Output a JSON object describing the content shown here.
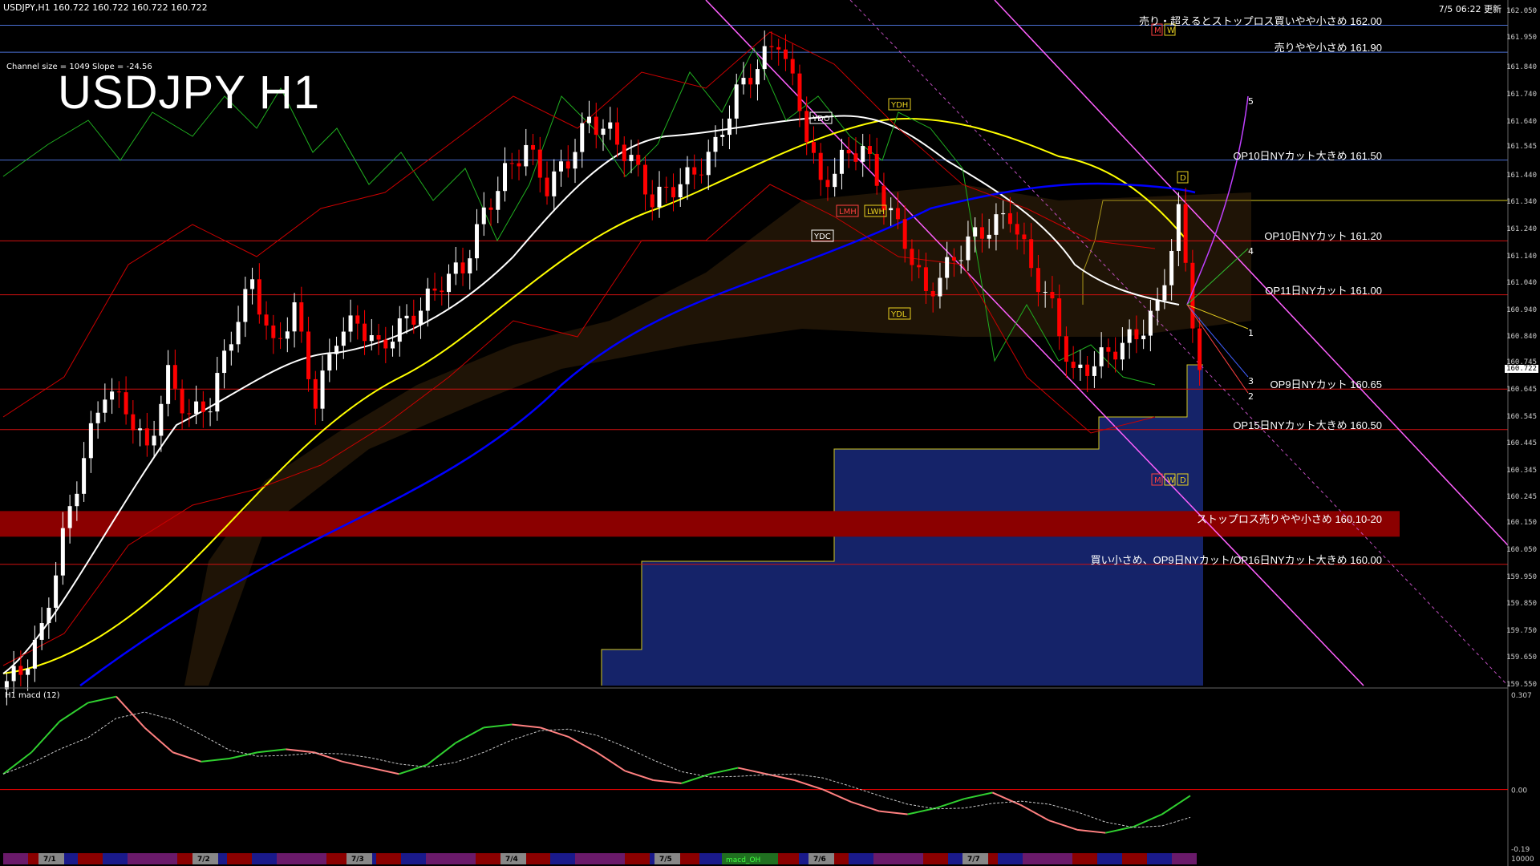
{
  "header": {
    "symbol_info": "USDJPY,H1  160.722 160.722 160.722 160.722",
    "updated": "7/5 06:22 更新",
    "channel_info": "Channel size = 1049 Slope = -24.56",
    "title": "USDJPY H1",
    "subwindow_title": "H1  macd (12)"
  },
  "price_axis": [
    "162.050",
    "161.950",
    "161.840",
    "161.740",
    "161.640",
    "161.545",
    "161.440",
    "161.340",
    "161.240",
    "161.140",
    "161.040",
    "160.940",
    "160.840",
    "160.745",
    "160.645",
    "160.545",
    "160.445",
    "160.345",
    "160.245",
    "160.150",
    "160.050",
    "159.950",
    "159.850",
    "159.750",
    "159.650",
    "159.550"
  ],
  "current_price": "160.722",
  "macd_axis": {
    "top": "0.307",
    "zero": "0.00",
    "bottom": "-0.19",
    "bottom_bar": "10000"
  },
  "levels": [
    {
      "text": "売り・超えるとストップロス買いやや小さめ 162.00",
      "price": 162.0,
      "color": "#4a6fd4"
    },
    {
      "text": "売りやや小さめ 161.90",
      "price": 161.9,
      "color": "#4a6fd4"
    },
    {
      "text": "OP10日NYカット大きめ 161.50",
      "price": 161.5,
      "color": "#4a6fd4"
    },
    {
      "text": "OP10日NYカット 161.20",
      "price": 161.2,
      "color": "#d01010"
    },
    {
      "text": "OP11日NYカット 161.00",
      "price": 161.0,
      "color": "#d01010"
    },
    {
      "text": "OP9日NYカット 160.65",
      "price": 160.65,
      "color": "#d01010"
    },
    {
      "text": "OP15日NYカット大きめ 160.50",
      "price": 160.5,
      "color": "#d01010"
    },
    {
      "text": "ストップロス売りやや小さめ 160.10-20",
      "price": 160.15,
      "color": "#8b0000"
    },
    {
      "text": "買い小さめ、OP9日NYカット/OP16日NYカット大きめ 160.00",
      "price": 160.0,
      "color": "#d01010"
    }
  ],
  "markers": {
    "ydo": "YDO",
    "ydh": "YDH",
    "ydc": "YDC",
    "ydl": "YDL",
    "lmh": "LMH",
    "lwh": "LWH",
    "d": "D",
    "m": "M",
    "w": "W",
    "n1": "1",
    "n2": "2",
    "n3": "3",
    "n4": "4",
    "n5": "5"
  },
  "dates": [
    "7/1",
    "7/2",
    "7/3",
    "7/4",
    "7/5",
    "7/6",
    "7/7"
  ],
  "bottom_bar_label": "macd_OH",
  "colors": {
    "up": "#ffffff",
    "down": "#ff0000",
    "ma_fast": "#ffffff",
    "ma_mid": "#ffff00",
    "ma_slow": "#0000ff",
    "kumo": "#1c2f8c",
    "channel": "#ff60ff",
    "macd": "#30d030",
    "macd_neg": "#ff8080",
    "signal": "#c8c8c8",
    "zero": "#ff0000"
  },
  "chart_data": {
    "type": "line",
    "title": "USDJPY H1",
    "xlabel": "",
    "ylabel": "",
    "ylim": [
      159.55,
      162.07
    ],
    "x": [
      "7/1",
      "7/2",
      "7/3",
      "7/4",
      "7/5",
      "7/6",
      "7/7"
    ],
    "series": [
      {
        "values": [
          159.6,
          159.75,
          160.1,
          160.4,
          160.65,
          160.58,
          160.42,
          160.7,
          160.55,
          160.6,
          160.85,
          161.05,
          160.8,
          160.95,
          160.6,
          160.85,
          160.9,
          160.8,
          160.88,
          160.95,
          161.05,
          161.1,
          161.3,
          161.45,
          161.55,
          161.4,
          161.5,
          161.65,
          161.6,
          161.5,
          161.35,
          161.4,
          161.45,
          161.55,
          161.75,
          161.85,
          161.95,
          161.7,
          161.4,
          161.5,
          161.55,
          161.35,
          161.2,
          161.0,
          161.1,
          161.2,
          161.25,
          161.3,
          161.1,
          160.95,
          160.7,
          160.75,
          160.8,
          160.85,
          160.95,
          161.3,
          160.722
        ]
      }
    ],
    "macd": {
      "range": [
        -0.19,
        0.307
      ],
      "values": [
        0.05,
        0.12,
        0.22,
        0.28,
        0.3,
        0.2,
        0.12,
        0.09,
        0.1,
        0.12,
        0.13,
        0.12,
        0.09,
        0.07,
        0.05,
        0.08,
        0.15,
        0.2,
        0.21,
        0.2,
        0.17,
        0.12,
        0.06,
        0.03,
        0.02,
        0.05,
        0.07,
        0.05,
        0.03,
        0.0,
        -0.04,
        -0.07,
        -0.08,
        -0.06,
        -0.03,
        -0.01,
        -0.05,
        -0.1,
        -0.13,
        -0.14,
        -0.12,
        -0.08,
        -0.02
      ]
    }
  }
}
